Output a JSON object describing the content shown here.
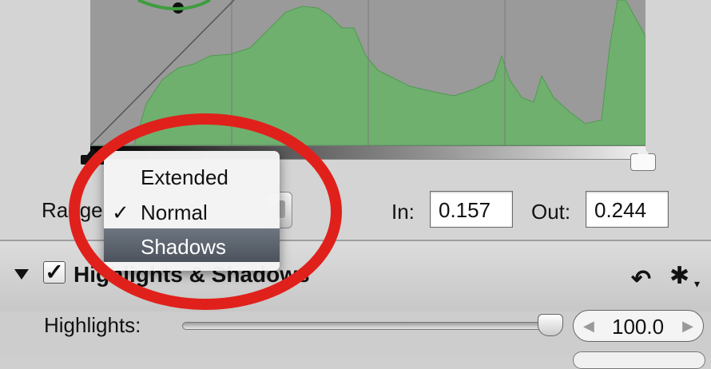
{
  "range": {
    "label": "Range",
    "menu": [
      {
        "label": "Extended",
        "checked": false,
        "highlighted": false
      },
      {
        "label": "Normal",
        "checked": true,
        "highlighted": false
      },
      {
        "label": "Shadows",
        "checked": false,
        "highlighted": true
      }
    ],
    "checkmark": "✓"
  },
  "levels": {
    "in_label": "In:",
    "in_value": "0.157",
    "out_label": "Out:",
    "out_value": "0.244"
  },
  "highlights_shadows": {
    "title": "Highlights & Shadows",
    "enabled_mark": "✓",
    "highlights_label": "Highlights:",
    "highlights_value": "100.0",
    "highlights_level": 0.95
  },
  "icons": {
    "disclosure": "disclosure-triangle-icon",
    "reset": "reset-arrow-icon",
    "gear": "gear-icon"
  },
  "colors": {
    "histogram_fill": "#6fb06f",
    "annotation": "#e0211b",
    "menu_highlight": "#586170"
  }
}
